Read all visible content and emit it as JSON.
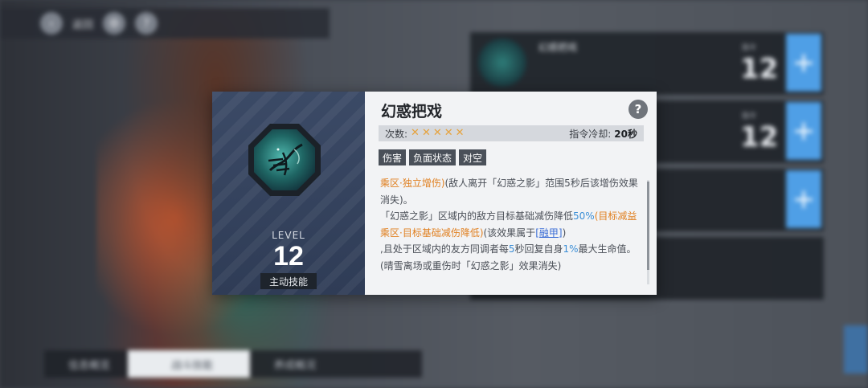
{
  "background": {
    "topbar": {
      "back_label": "返回",
      "icon_a": "gear-icon",
      "icon_b": "help-icon",
      "help_glyph": "?"
    },
    "cards": [
      {
        "title": "幻惑把戏",
        "cd_label": "指令",
        "cd_value": "12",
        "plus": "+"
      },
      {
        "title": "",
        "cd_label": "指令",
        "cd_value": "12",
        "plus": "+"
      },
      {
        "title": "",
        "cd_label": "",
        "cd_value": "",
        "plus": "+"
      }
    ],
    "bottom_tabs": [
      "信息概览",
      "战斗技能",
      "养成概况"
    ]
  },
  "popup": {
    "title": "幻惑把戏",
    "help_glyph": "?",
    "level_label": "LEVEL",
    "level_value": "12",
    "type_badge": "主动技能",
    "charges_label": "次数:",
    "charges": [
      {
        "icon": "charge-icon",
        "glyph": "✕"
      },
      {
        "icon": "charge-icon",
        "glyph": "✕"
      },
      {
        "icon": "charge-icon",
        "glyph": "✕"
      },
      {
        "icon": "charge-icon",
        "glyph": "✕"
      },
      {
        "icon": "charge-icon",
        "glyph": "✕"
      }
    ],
    "cooldown_label": "指令冷却:",
    "cooldown_value": "20秒",
    "tags": [
      "伤害",
      "负面状态",
      "对空"
    ],
    "description": {
      "l1_orange": "乘区·独立增伤)",
      "l1_rest": "(敌人离开「幻惑之影」范围5秒后该增伤效果消失)。",
      "l2_a": "「幻惑之影」区域内的敌方目标基础减伤降低",
      "l2_pct": "50%",
      "l2_orange": "(目标减益乘区·目标基础减伤降低)",
      "l2_b": "(该效果属于",
      "l2_link": "[融甲]",
      "l2_c": ")",
      "l3_a": ",且处于区域内的友方同调者每",
      "l3_sec": "5",
      "l3_b": "秒回复自身",
      "l3_pct": "1%",
      "l3_c": "最大生命值。",
      "l4": "(晴雪离场或重伤时「幻惑之影」效果消失)"
    },
    "colors": {
      "highlight_orange": "#e07f1f",
      "highlight_blue": "#3d8fd6",
      "panel_dark": "#34415c",
      "panel_light": "#f2f3f5"
    }
  }
}
